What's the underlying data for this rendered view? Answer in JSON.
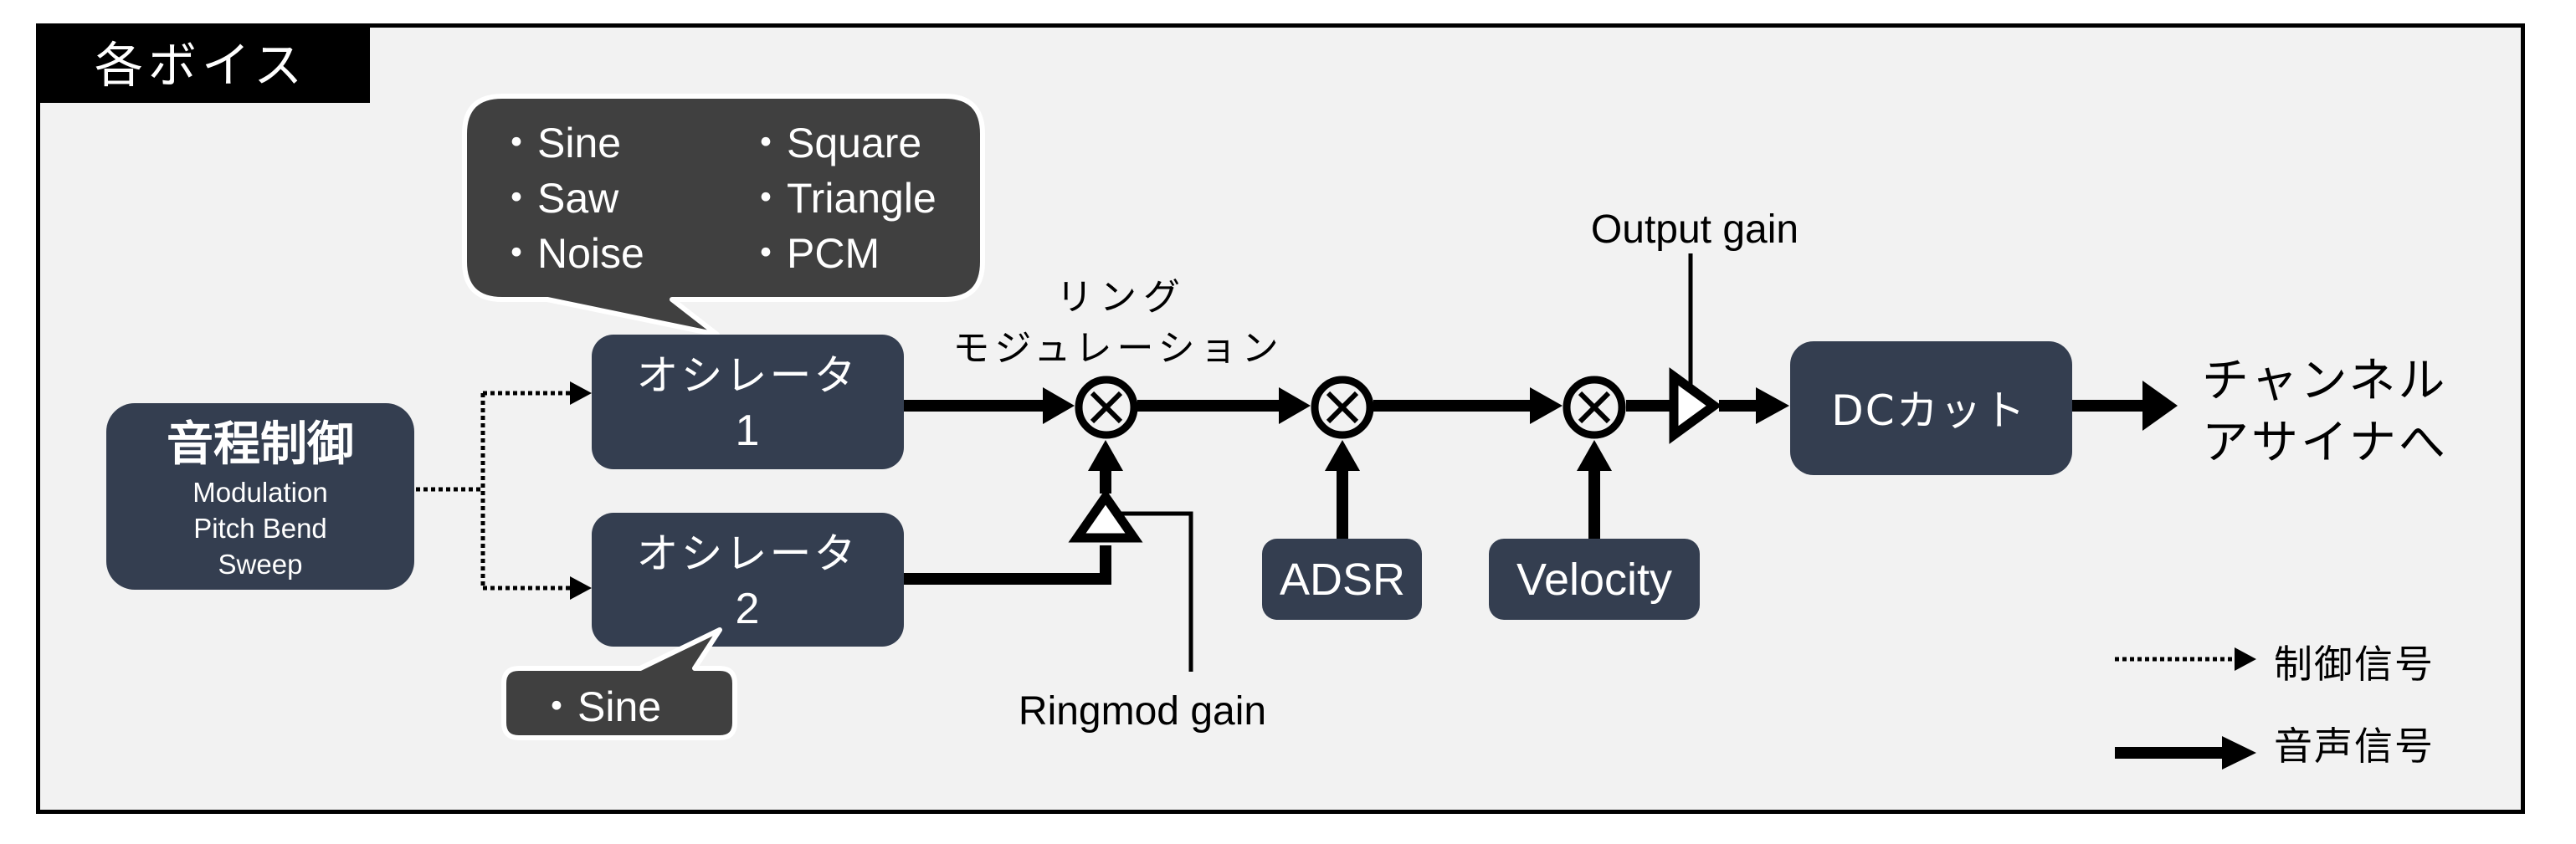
{
  "title": "各ボイス",
  "colors": {
    "block": "#343e50",
    "bubble": "#404040",
    "panel": "#f2f2f2",
    "line": "#000000"
  },
  "pitch_control": {
    "title": "音程制御",
    "lines": [
      "Modulation",
      "Pitch Bend",
      "Sweep"
    ]
  },
  "oscillator1": {
    "label": "オシレータ",
    "number": "1",
    "waveforms_left": [
      "・Sine",
      "・Saw",
      "・Noise"
    ],
    "waveforms_right": [
      "・Square",
      "・Triangle",
      "・PCM"
    ]
  },
  "oscillator2": {
    "label": "オシレータ",
    "number": "2",
    "waveforms": [
      "・Sine"
    ]
  },
  "ring_mod": {
    "label_line1": "リング",
    "label_line2": "モジュレーション",
    "gain_label": "Ringmod gain",
    "multiply_icon": "circled-times"
  },
  "adsr": {
    "label": "ADSR"
  },
  "velocity": {
    "label": "Velocity"
  },
  "output_gain": {
    "label": "Output gain"
  },
  "dc_cut": {
    "label": "DCカット"
  },
  "destination": {
    "line1": "チャンネル",
    "line2": "アサイナへ"
  },
  "legend": {
    "control_signal": "制御信号",
    "audio_signal": "音声信号"
  }
}
